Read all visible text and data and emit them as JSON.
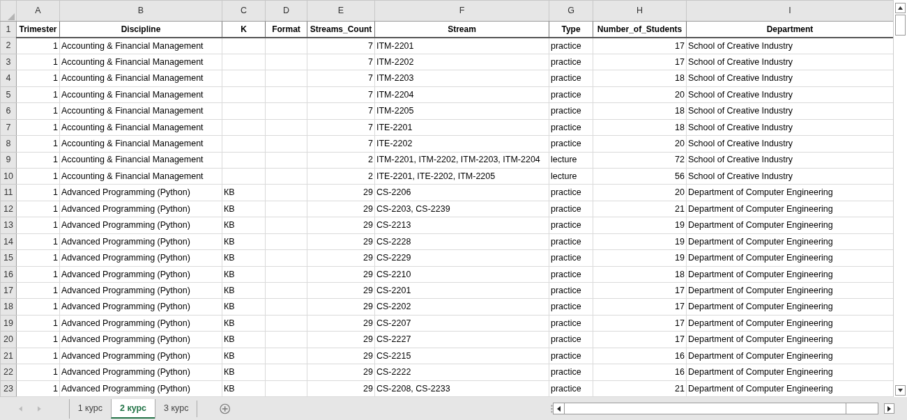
{
  "sheet": {
    "columns": [
      "A",
      "B",
      "C",
      "D",
      "E",
      "F",
      "G",
      "H",
      "I"
    ],
    "rows": [
      {
        "number": "1",
        "kind": "header",
        "cells": [
          "Trimester",
          "Discipline",
          "K",
          "Format",
          "Streams_Count",
          "Stream",
          "Type",
          "Number_of_Students",
          "Department"
        ]
      },
      {
        "number": "2",
        "kind": "data",
        "cells": [
          "1",
          "Accounting & Financial Management",
          null,
          null,
          "7",
          "ITM-2201",
          "practice",
          "17",
          "School of Creative Industry"
        ]
      },
      {
        "number": "3",
        "kind": "data",
        "cells": [
          "1",
          "Accounting & Financial Management",
          null,
          null,
          "7",
          "ITM-2202",
          "practice",
          "17",
          "School of Creative Industry"
        ]
      },
      {
        "number": "4",
        "kind": "data",
        "cells": [
          "1",
          "Accounting & Financial Management",
          null,
          null,
          "7",
          "ITM-2203",
          "practice",
          "18",
          "School of Creative Industry"
        ]
      },
      {
        "number": "5",
        "kind": "data",
        "cells": [
          "1",
          "Accounting & Financial Management",
          null,
          null,
          "7",
          "ITM-2204",
          "practice",
          "20",
          "School of Creative Industry"
        ]
      },
      {
        "number": "6",
        "kind": "data",
        "cells": [
          "1",
          "Accounting & Financial Management",
          null,
          null,
          "7",
          "ITM-2205",
          "practice",
          "18",
          "School of Creative Industry"
        ]
      },
      {
        "number": "7",
        "kind": "data",
        "cells": [
          "1",
          "Accounting & Financial Management",
          null,
          null,
          "7",
          "ITE-2201",
          "practice",
          "18",
          "School of Creative Industry"
        ]
      },
      {
        "number": "8",
        "kind": "data",
        "cells": [
          "1",
          "Accounting & Financial Management",
          null,
          null,
          "7",
          "ITE-2202",
          "practice",
          "20",
          "School of Creative Industry"
        ]
      },
      {
        "number": "9",
        "kind": "data",
        "cells": [
          "1",
          "Accounting & Financial Management",
          null,
          null,
          "2",
          "ITM-2201, ITM-2202, ITM-2203, ITM-2204",
          "lecture",
          "72",
          "School of Creative Industry"
        ]
      },
      {
        "number": "10",
        "kind": "data",
        "cells": [
          "1",
          "Accounting & Financial Management",
          null,
          null,
          "2",
          "ITE-2201, ITE-2202, ITM-2205",
          "lecture",
          "56",
          "School of Creative Industry"
        ]
      },
      {
        "number": "11",
        "kind": "data",
        "cells": [
          "1",
          "Advanced Programming (Python)",
          "КВ",
          null,
          "29",
          "CS-2206",
          "practice",
          "20",
          "Department of Computer Engineering"
        ]
      },
      {
        "number": "12",
        "kind": "data",
        "cells": [
          "1",
          "Advanced Programming (Python)",
          "КВ",
          null,
          "29",
          "CS-2203, CS-2239",
          "practice",
          "21",
          "Department of Computer Engineering"
        ]
      },
      {
        "number": "13",
        "kind": "data",
        "cells": [
          "1",
          "Advanced Programming (Python)",
          "КВ",
          null,
          "29",
          "CS-2213",
          "practice",
          "19",
          "Department of Computer Engineering"
        ]
      },
      {
        "number": "14",
        "kind": "data",
        "cells": [
          "1",
          "Advanced Programming (Python)",
          "КВ",
          null,
          "29",
          "CS-2228",
          "practice",
          "19",
          "Department of Computer Engineering"
        ]
      },
      {
        "number": "15",
        "kind": "data",
        "cells": [
          "1",
          "Advanced Programming (Python)",
          "КВ",
          null,
          "29",
          "CS-2229",
          "practice",
          "19",
          "Department of Computer Engineering"
        ]
      },
      {
        "number": "16",
        "kind": "data",
        "cells": [
          "1",
          "Advanced Programming (Python)",
          "КВ",
          null,
          "29",
          "CS-2210",
          "practice",
          "18",
          "Department of Computer Engineering"
        ]
      },
      {
        "number": "17",
        "kind": "data",
        "cells": [
          "1",
          "Advanced Programming (Python)",
          "КВ",
          null,
          "29",
          "CS-2201",
          "practice",
          "17",
          "Department of Computer Engineering"
        ]
      },
      {
        "number": "18",
        "kind": "data",
        "cells": [
          "1",
          "Advanced Programming (Python)",
          "КВ",
          null,
          "29",
          "CS-2202",
          "practice",
          "17",
          "Department of Computer Engineering"
        ]
      },
      {
        "number": "19",
        "kind": "data",
        "cells": [
          "1",
          "Advanced Programming (Python)",
          "КВ",
          null,
          "29",
          "CS-2207",
          "practice",
          "17",
          "Department of Computer Engineering"
        ]
      },
      {
        "number": "20",
        "kind": "data",
        "cells": [
          "1",
          "Advanced Programming (Python)",
          "КВ",
          null,
          "29",
          "CS-2227",
          "practice",
          "17",
          "Department of Computer Engineering"
        ]
      },
      {
        "number": "21",
        "kind": "data",
        "cells": [
          "1",
          "Advanced Programming (Python)",
          "КВ",
          null,
          "29",
          "CS-2215",
          "practice",
          "16",
          "Department of Computer Engineering"
        ]
      },
      {
        "number": "22",
        "kind": "data",
        "cells": [
          "1",
          "Advanced Programming (Python)",
          "КВ",
          null,
          "29",
          "CS-2222",
          "practice",
          "16",
          "Department of Computer Engineering"
        ]
      },
      {
        "number": "23",
        "kind": "data",
        "cells": [
          "1",
          "Advanced Programming (Python)",
          "КВ",
          null,
          "29",
          "CS-2208, CS-2233",
          "practice",
          "21",
          "Department of Computer Engineering"
        ]
      }
    ]
  },
  "tabs": [
    {
      "label": "1 курс",
      "selected": false
    },
    {
      "label": "2 курс",
      "selected": true
    },
    {
      "label": "3 курс",
      "selected": false
    }
  ]
}
